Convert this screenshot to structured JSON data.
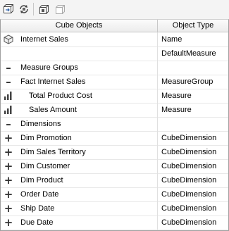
{
  "toolbar": {
    "buttons": [
      {
        "name": "process-cube-icon"
      },
      {
        "name": "reconnect-icon"
      },
      {
        "name": "deploy-icon"
      },
      {
        "name": "browse-icon"
      }
    ]
  },
  "grid": {
    "columns": [
      "Cube Objects",
      "Object Type"
    ],
    "rows": [
      {
        "icon": "cube-icon",
        "label": "Internet Sales",
        "type": "Name"
      },
      {
        "icon": "",
        "label": "",
        "type": "DefaultMeasure"
      },
      {
        "icon": "collapse-icon",
        "label": "Measure Groups",
        "type": ""
      },
      {
        "icon": "collapse-icon",
        "label": "Fact Internet Sales",
        "type": "MeasureGroup"
      },
      {
        "icon": "measure-icon",
        "label": "Total Product Cost",
        "type": "Measure"
      },
      {
        "icon": "measure-icon",
        "label": "Sales Amount",
        "type": "Measure"
      },
      {
        "icon": "collapse-icon",
        "label": "Dimensions",
        "type": ""
      },
      {
        "icon": "expand-icon",
        "label": "Dim Promotion",
        "type": "CubeDimension"
      },
      {
        "icon": "expand-icon",
        "label": "Dim Sales Territory",
        "type": "CubeDimension"
      },
      {
        "icon": "expand-icon",
        "label": "Dim Customer",
        "type": "CubeDimension"
      },
      {
        "icon": "expand-icon",
        "label": "Dim Product",
        "type": "CubeDimension"
      },
      {
        "icon": "expand-icon",
        "label": "Order Date",
        "type": "CubeDimension"
      },
      {
        "icon": "expand-icon",
        "label": "Ship Date",
        "type": "CubeDimension"
      },
      {
        "icon": "expand-icon",
        "label": "Due Date",
        "type": "CubeDimension"
      }
    ]
  }
}
